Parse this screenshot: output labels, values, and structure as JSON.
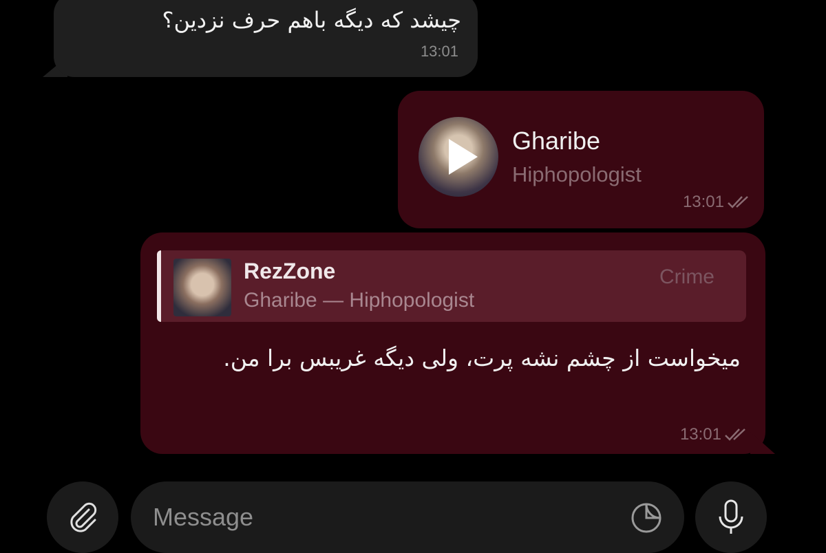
{
  "messages": {
    "incoming": {
      "text": "چیشد که دیگه باهم حرف نزدین؟",
      "time": "13:01"
    },
    "audio": {
      "title": "Gharibe",
      "artist": "Hiphopologist",
      "time": "13:01",
      "status": "read"
    },
    "reply": {
      "quote": {
        "name": "RezZone",
        "subtitle": "Gharibe — Hiphopologist",
        "tag": "Crime"
      },
      "text": "میخواست از چشم نشه پرت، ولی دیگه غریبس برا من.",
      "time": "13:01",
      "status": "read"
    }
  },
  "composer": {
    "placeholder": "Message"
  },
  "icons": {
    "attach": "paperclip-icon",
    "sticker": "sticker-icon",
    "voice": "microphone-icon",
    "play": "play-icon",
    "check": "double-check-icon"
  },
  "colors": {
    "outgoing_bubble": "#3a0712",
    "incoming_bubble": "#1f1f1f",
    "quote_background": "#5a1d2a"
  }
}
